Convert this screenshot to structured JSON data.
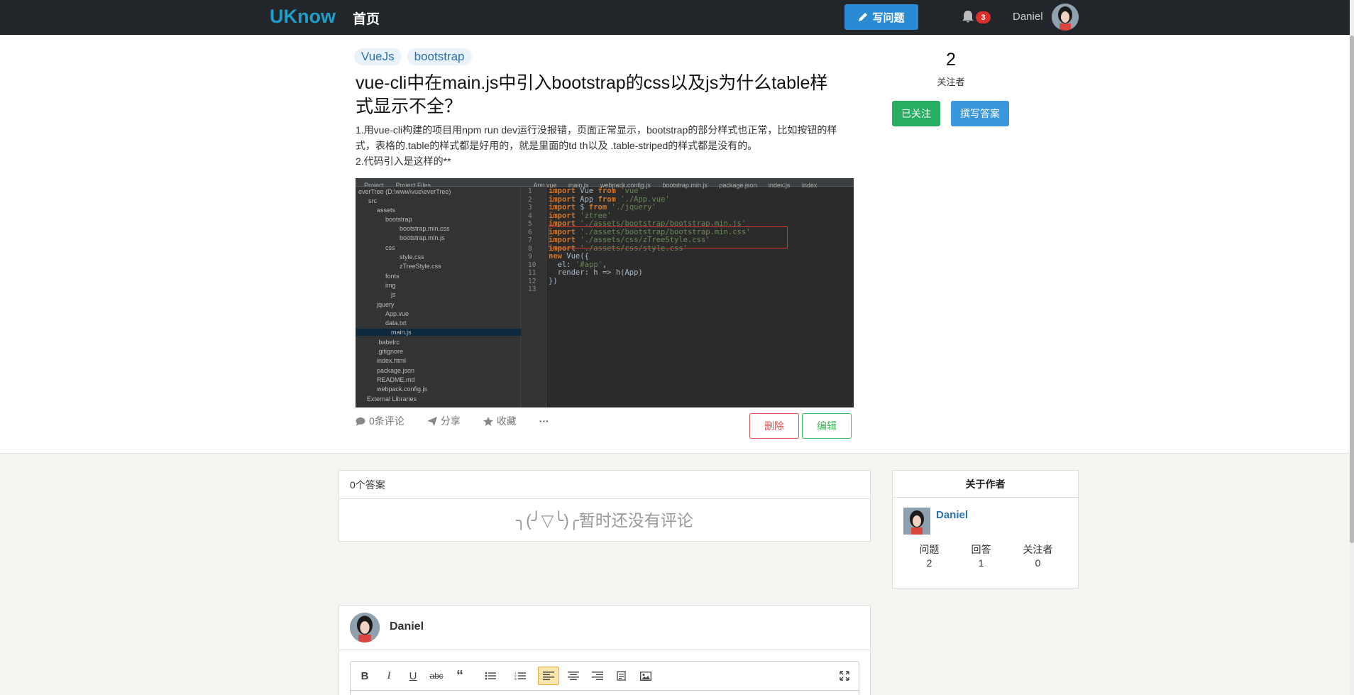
{
  "navbar": {
    "brand": "UKnow",
    "home": "首页",
    "ask_button": "写问题",
    "notification_count": "3",
    "username": "Daniel"
  },
  "question": {
    "tags": [
      "VueJs",
      "bootstrap"
    ],
    "title": "vue-cli中在main.js中引入bootstrap的css以及js为什么table样式显示不全？",
    "body_lines": [
      "1.用vue-cli构建的项目用npm run dev运行没报错，页面正常显示，bootstrap的部分样式也正常，比如按钮的样式，表格的.table的样式都是好用的，就是里面的td th以及 .table-striped的样式都是没有的。",
      "2.代码引入是这样的**"
    ],
    "screenshot": {
      "tabs": [
        "Project",
        "Project Files",
        "App.vue",
        "main.js",
        "webpack.config.js",
        "bootstrap.min.js",
        "package.json",
        "index.js",
        "index"
      ],
      "tree": [
        "everTree (D:\\www\\vue\\everTree)",
        "src",
        "assets",
        "bootstrap",
        "bootstrap.min.css",
        "bootstrap.min.js",
        "css",
        "style.css",
        "zTreeStyle.css",
        "fonts",
        "img",
        "js",
        "jquery",
        "App.vue",
        "data.txt",
        "main.js",
        ".babelrc",
        ".gitignore",
        "index.html",
        "package.json",
        "README.md",
        "webpack.config.js",
        "External Libraries"
      ],
      "line_numbers": [
        "1",
        "2",
        "3",
        "4",
        "5",
        "6",
        "7",
        "8",
        "9",
        "10",
        "11",
        "12",
        "13"
      ],
      "code": [
        "import Vue from 'vue'",
        "import App from './App.vue'",
        "import $ from './jquery'",
        "import 'ztree'",
        "import './assets/bootstrap/bootstrap.min.js'",
        "import './assets/bootstrap/bootstrap.min.css'",
        "import './assets/css/zTreeStyle.css'",
        "import './assets/css/style.css'",
        "new Vue({",
        "  el: '#app',",
        "  render: h => h(App)",
        "})",
        ""
      ]
    },
    "actions": {
      "comments": "0条评论",
      "share": "分享",
      "favorite": "收藏",
      "more": "···"
    },
    "delete_button": "删除",
    "edit_button": "编辑"
  },
  "sidebar": {
    "follower_count": "2",
    "follower_label": "关注者",
    "followed_button": "已关注",
    "write_answer_button": "撰写答案"
  },
  "answers": {
    "header": "0个答案",
    "empty_text": "╮(╯▽╰)╭暂时还没有评论"
  },
  "author": {
    "header": "关于作者",
    "name": "Daniel",
    "stats": [
      {
        "label": "问题",
        "value": "2"
      },
      {
        "label": "回答",
        "value": "1"
      },
      {
        "label": "关注者",
        "value": "0"
      }
    ]
  },
  "editor": {
    "username": "Daniel",
    "toolbar_icons": [
      "bold-icon",
      "italic-icon",
      "underline-icon",
      "strikethrough-icon",
      "quote-icon",
      "bullet-list-icon",
      "numbered-list-icon",
      "align-left-icon",
      "align-center-icon",
      "align-right-icon",
      "code-block-icon",
      "image-icon",
      "fullscreen-icon"
    ]
  },
  "colors": {
    "navbar_bg": "#22262a",
    "brand": "#1e9ec8",
    "primary": "#2a8ad4",
    "success": "#27ae60",
    "danger": "#d9534f",
    "badge": "#d9302b"
  }
}
